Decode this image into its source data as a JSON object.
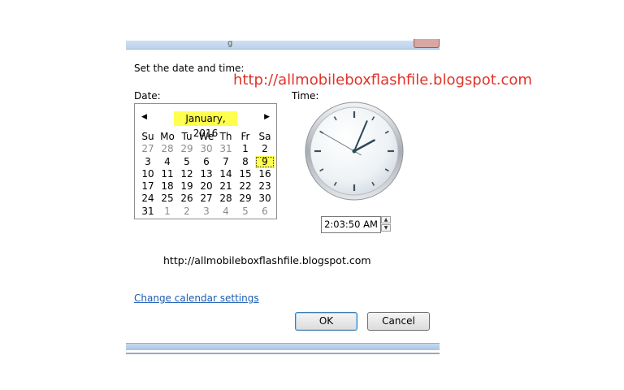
{
  "dialog": {
    "title_fragment": "g",
    "heading": "Set the date and time:",
    "watermark_red": "http://allmobileboxflashfile.blogspot.com",
    "watermark_black": "http://allmobileboxflashfile.blogspot.com",
    "date_label": "Date:",
    "time_label": "Time:",
    "calendar": {
      "prev_icon": "◀",
      "next_icon": "▶",
      "month_label": "January, 2016",
      "weekdays": [
        "Su",
        "Mo",
        "Tu",
        "We",
        "Th",
        "Fr",
        "Sa"
      ],
      "weeks": [
        [
          "27",
          "28",
          "29",
          "30",
          "31",
          "1",
          "2"
        ],
        [
          "3",
          "4",
          "5",
          "6",
          "7",
          "8",
          "9"
        ],
        [
          "10",
          "11",
          "12",
          "13",
          "14",
          "15",
          "16"
        ],
        [
          "17",
          "18",
          "19",
          "20",
          "21",
          "22",
          "23"
        ],
        [
          "24",
          "25",
          "26",
          "27",
          "28",
          "29",
          "30"
        ],
        [
          "31",
          "1",
          "2",
          "3",
          "4",
          "5",
          "6"
        ]
      ],
      "selected_day": "9"
    },
    "clock": {
      "hours": 2,
      "minutes": 3,
      "seconds": 50
    },
    "time_value": "2:03:50 AM",
    "spin_up_icon": "▲",
    "spin_down_icon": "▼",
    "change_calendar_link": "Change calendar settings",
    "ok_label": "OK",
    "cancel_label": "Cancel"
  },
  "colors": {
    "highlight": "#ffff4d",
    "link": "#1b5cb2",
    "watermark": "#e0332a"
  }
}
